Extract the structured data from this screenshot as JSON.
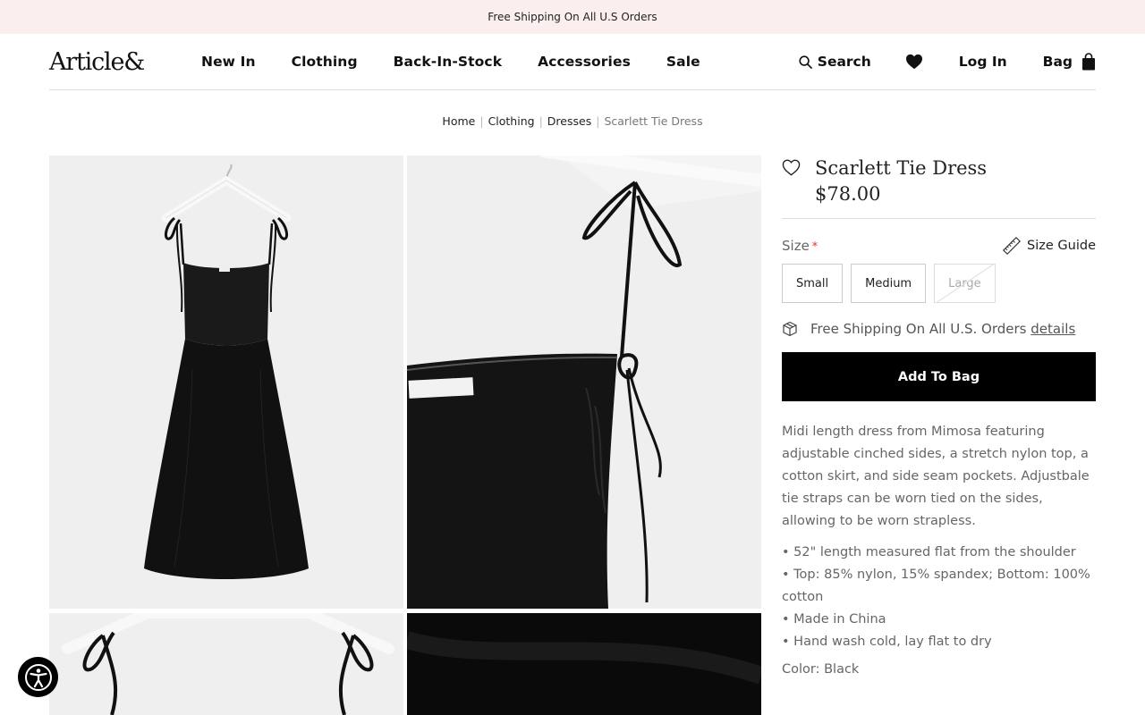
{
  "announcement": "Free Shipping On All U.S Orders",
  "header": {
    "logo": "Article&",
    "nav": [
      "New In",
      "Clothing",
      "Back-In-Stock",
      "Accessories",
      "Sale"
    ],
    "search_label": "Search",
    "login_label": "Log In",
    "bag_label": "Bag"
  },
  "breadcrumb": [
    "Home",
    "Clothing",
    "Dresses",
    "Scarlett Tie Dress"
  ],
  "product": {
    "title": "Scarlett Tie Dress",
    "price": "$78.00",
    "size_label": "Size",
    "required_mark": "*",
    "size_guide_label": "Size Guide",
    "sizes": [
      {
        "label": "Small",
        "available": true
      },
      {
        "label": "Medium",
        "available": true
      },
      {
        "label": "Large",
        "available": false
      }
    ],
    "shipping_text": "Free Shipping On All U.S. Orders",
    "shipping_link": "details",
    "add_to_bag": "Add To Bag",
    "description": "Midi length dress from Mimosa featuring adjustable cinched sides, a stretch nylon top, a cotton skirt, and side seam pockets. Adjustbale tie straps can be worn tied on the sides, allowing to be worn strapless.",
    "bullets": [
      "• 52\" length measured flat from the shoulder",
      "• Top: 85% nylon, 15% spandex; Bottom: 100% cotton",
      "• Made in China",
      "• Hand wash cold, lay flat to dry"
    ],
    "color": "Color: Black"
  },
  "icons": {
    "search": "search-icon",
    "wishlist": "heart-icon",
    "bag": "bag-icon",
    "size_guide": "ruler-icon",
    "shipping": "box-icon",
    "accessibility": "accessibility-icon"
  }
}
